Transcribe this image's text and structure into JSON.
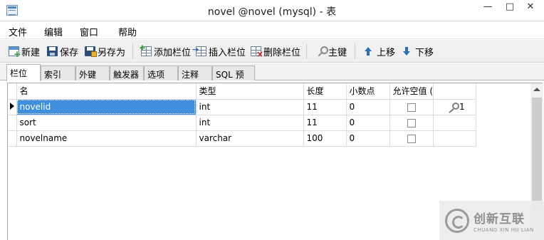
{
  "window": {
    "title": "novel @novel (mysql) - 表",
    "minimize": "—",
    "maximize": "□",
    "close": "✕"
  },
  "menu": [
    "文件",
    "编辑",
    "窗口",
    "帮助"
  ],
  "toolbar": {
    "new": "新建",
    "save": "保存",
    "save_as": "另存为",
    "add_field": "添加栏位",
    "insert_field": "插入栏位",
    "delete_field": "删除栏位",
    "primary_key": "主键",
    "move_up": "上移",
    "move_down": "下移"
  },
  "tabs": [
    "栏位",
    "索引",
    "外键",
    "触发器",
    "选项",
    "注释",
    "SQL 预览"
  ],
  "active_tab": "栏位",
  "table": {
    "headers": [
      "名",
      "类型",
      "长度",
      "小数点",
      "允许空值 ("
    ],
    "rows": [
      {
        "name": "novelid",
        "type": "int",
        "length": "11",
        "decimals": "0",
        "allow_null": false,
        "key": "1",
        "selected": true
      },
      {
        "name": "sort",
        "type": "int",
        "length": "11",
        "decimals": "0",
        "allow_null": false,
        "key": "",
        "selected": false
      },
      {
        "name": "novelname",
        "type": "varchar",
        "length": "100",
        "decimals": "0",
        "allow_null": false,
        "key": "",
        "selected": false
      }
    ]
  },
  "watermark": {
    "main": "创新互联",
    "sub": "CHUANG XIN HU LIAN"
  },
  "icons": {
    "app": "table-icon",
    "key": "key-icon",
    "up": "arrow-up-icon",
    "down": "arrow-down-icon"
  },
  "colors": {
    "selection": "#3f8fdc"
  }
}
